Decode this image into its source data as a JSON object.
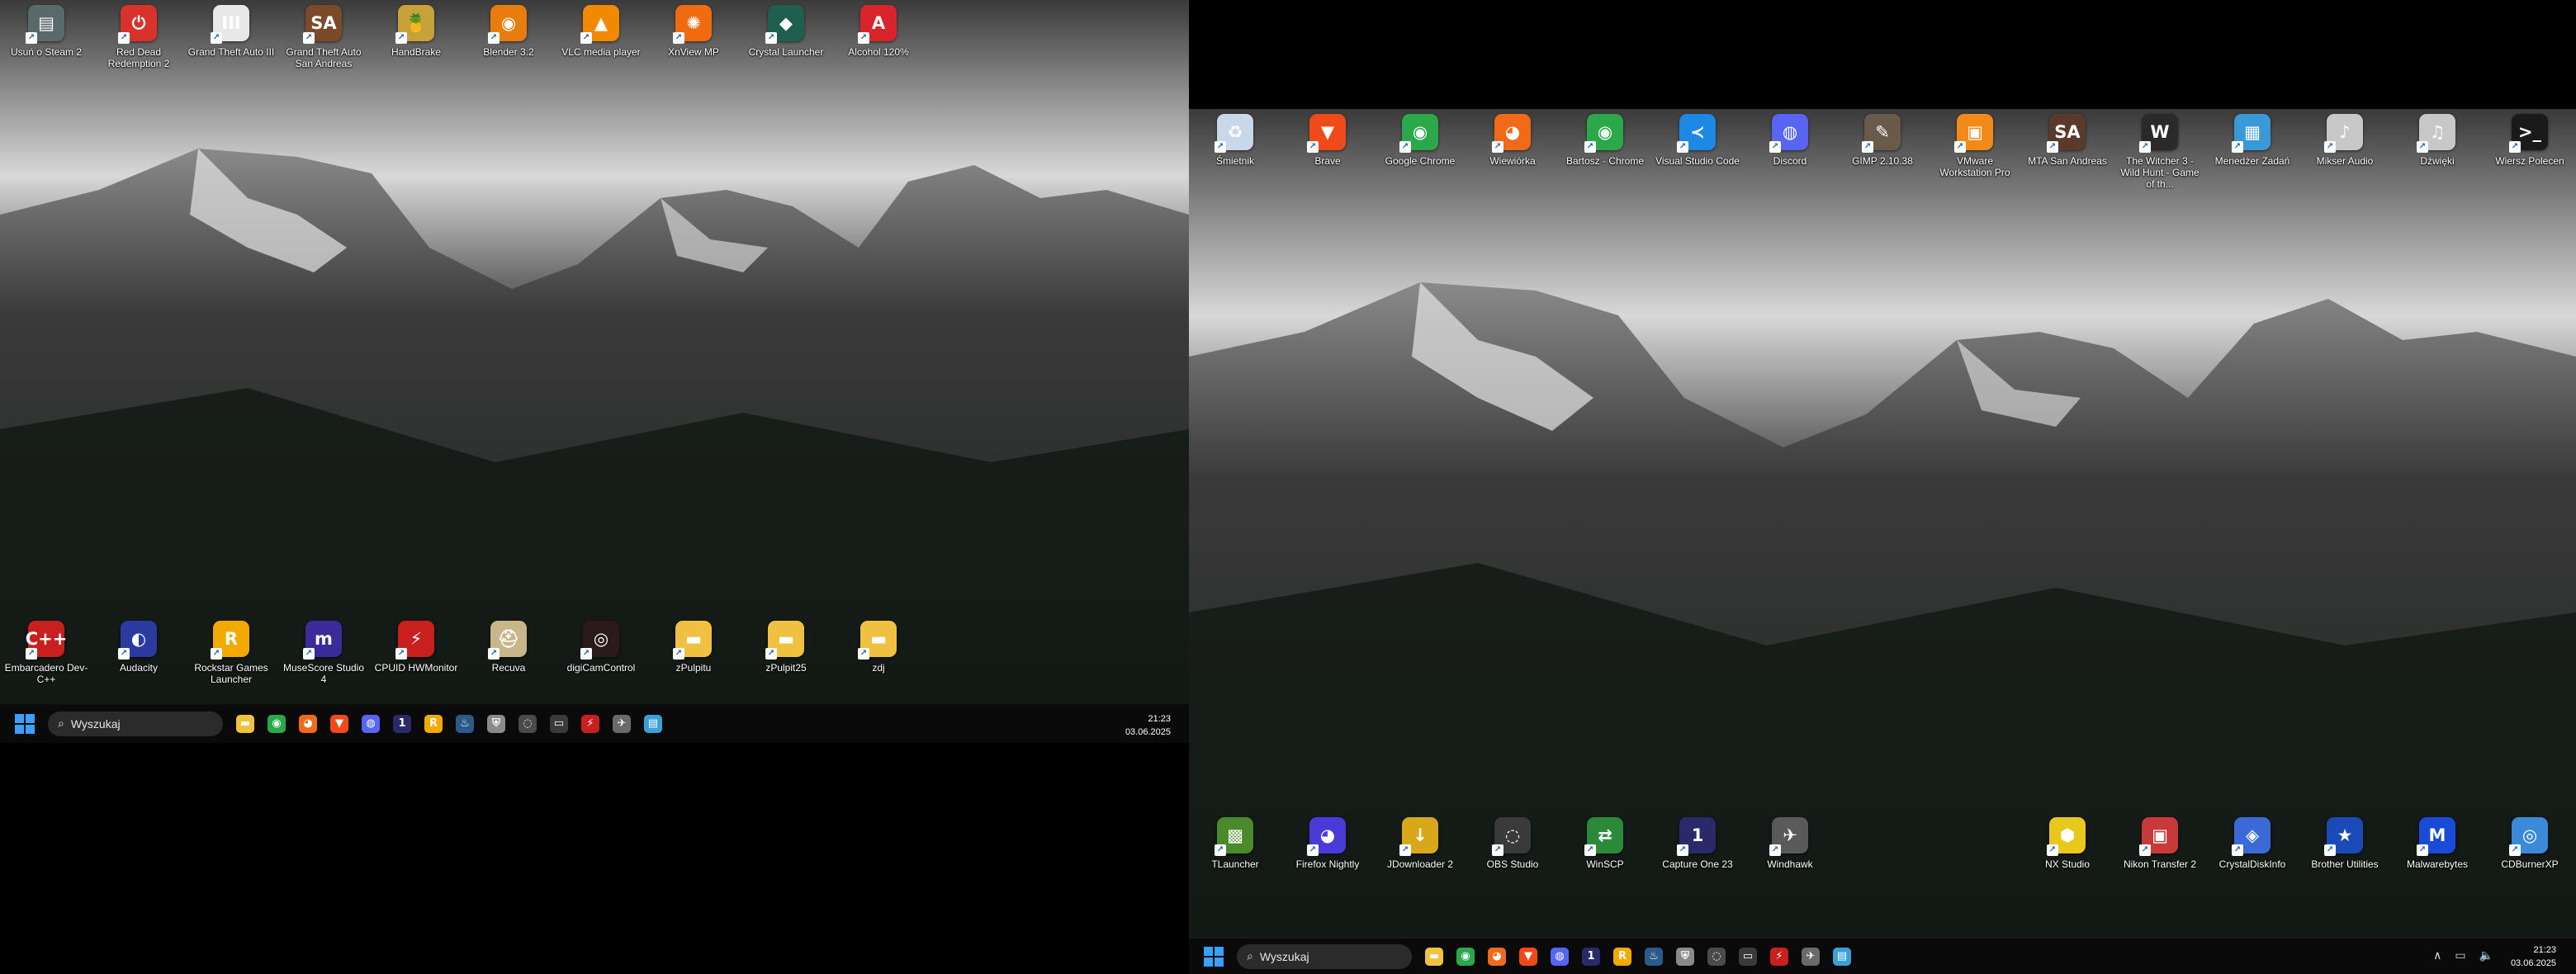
{
  "left_monitor": {
    "desktop_top_icons": [
      {
        "label": "Usuń o Steam 2",
        "icon": "steam-uninstall-icon",
        "color": "#5a6a6a",
        "glyph": "▤"
      },
      {
        "label": "Red Dead Redemption 2",
        "icon": "rdr2-icon",
        "color": "#d8322a",
        "glyph": "⏻"
      },
      {
        "label": "Grand Theft Auto III",
        "icon": "gta3-icon",
        "color": "#e8e8e8",
        "glyph": "III"
      },
      {
        "label": "Grand Theft Auto San Andreas",
        "icon": "gtasa-icon",
        "color": "#7a4a2a",
        "glyph": "SA"
      },
      {
        "label": "HandBrake",
        "icon": "handbrake-icon",
        "color": "#c7a23a",
        "glyph": "🍍"
      },
      {
        "label": "Blender 3.2",
        "icon": "blender-icon",
        "color": "#e87d0d",
        "glyph": "◉"
      },
      {
        "label": "VLC media player",
        "icon": "vlc-icon",
        "color": "#f18a00",
        "glyph": "▲"
      },
      {
        "label": "XnView MP",
        "icon": "xnview-icon",
        "color": "#f06a10",
        "glyph": "✺"
      },
      {
        "label": "Crystal Launcher",
        "icon": "crystal-launcher-icon",
        "color": "#1f5f4f",
        "glyph": "◆"
      },
      {
        "label": "Alcohol 120%",
        "icon": "alcohol-icon",
        "color": "#d8242a",
        "glyph": "A"
      }
    ],
    "desktop_bottom_icons": [
      {
        "label": "Embarcadero Dev-C++",
        "icon": "devcpp-icon",
        "color": "#c8201e",
        "glyph": "C++"
      },
      {
        "label": "Audacity",
        "icon": "audacity-icon",
        "color": "#2a3aa0",
        "glyph": "◐"
      },
      {
        "label": "Rockstar Games Launcher",
        "icon": "rockstar-icon",
        "color": "#f2a900",
        "glyph": "R"
      },
      {
        "label": "MuseScore Studio 4",
        "icon": "musescore-icon",
        "color": "#3b2a9a",
        "glyph": "m"
      },
      {
        "label": "CPUID HWMonitor",
        "icon": "hwmonitor-icon",
        "color": "#c8201e",
        "glyph": "⚡"
      },
      {
        "label": "Recuva",
        "icon": "recuva-icon",
        "color": "#c9b58a",
        "glyph": "⛑"
      },
      {
        "label": "digiCamControl",
        "icon": "digicamcontrol-icon",
        "color": "#2a1a1a",
        "glyph": "◎"
      },
      {
        "label": "zPulpitu",
        "icon": "folder-icon",
        "color": "#f0c040",
        "glyph": "▬"
      },
      {
        "label": "zPulpit25",
        "icon": "folder-icon",
        "color": "#f0c040",
        "glyph": "▬"
      },
      {
        "label": "zdj",
        "icon": "folder-icon",
        "color": "#f0c040",
        "glyph": "▬"
      }
    ],
    "taskbar": {
      "search_placeholder": "Wyszukaj",
      "time": "21:23",
      "date": "03.06.2025",
      "apps": [
        {
          "icon": "file-explorer-icon",
          "color": "#f3c23c",
          "glyph": "▬"
        },
        {
          "icon": "chrome-icon",
          "color": "#2aa84a",
          "glyph": "◉"
        },
        {
          "icon": "firefox-icon",
          "color": "#f06a1a",
          "glyph": "◕"
        },
        {
          "icon": "brave-icon",
          "color": "#f04a1a",
          "glyph": "▼"
        },
        {
          "icon": "discord-icon",
          "color": "#5865f2",
          "glyph": "◍"
        },
        {
          "icon": "capture-one-icon",
          "color": "#2a2a6a",
          "glyph": "1"
        },
        {
          "icon": "rockstar-icon",
          "color": "#f2a900",
          "glyph": "R"
        },
        {
          "icon": "steam-icon",
          "color": "#2a5a8a",
          "glyph": "♨"
        },
        {
          "icon": "shield-icon",
          "color": "#8a8a8a",
          "glyph": "⛨"
        },
        {
          "icon": "obs-icon",
          "color": "#4a4a4a",
          "glyph": "◌"
        },
        {
          "icon": "terminal-icon",
          "color": "#3a3a3a",
          "glyph": "▭"
        },
        {
          "icon": "hwmonitor-icon",
          "color": "#c8201e",
          "glyph": "⚡"
        },
        {
          "icon": "windhawk-icon",
          "color": "#6a6a6a",
          "glyph": "✈"
        },
        {
          "icon": "notepad-icon",
          "color": "#3aa0d8",
          "glyph": "▤"
        }
      ]
    }
  },
  "right_monitor": {
    "desktop_top_icons": [
      {
        "label": "Śmietnik",
        "icon": "recycle-bin-icon",
        "color": "#c8d8e8",
        "glyph": "♻"
      },
      {
        "label": "Brave",
        "icon": "brave-icon",
        "color": "#f04a1a",
        "glyph": "▼"
      },
      {
        "label": "Google Chrome",
        "icon": "chrome-icon",
        "color": "#2aa84a",
        "glyph": "◉"
      },
      {
        "label": "Wiewiórka",
        "icon": "firefox-icon",
        "color": "#f06a1a",
        "glyph": "◕"
      },
      {
        "label": "Bartosz - Chrome",
        "icon": "chrome-profile-icon",
        "color": "#2aa84a",
        "glyph": "◉"
      },
      {
        "label": "Visual Studio Code",
        "icon": "vscode-icon",
        "color": "#1e88e5",
        "glyph": "≺"
      },
      {
        "label": "Discord",
        "icon": "discord-icon",
        "color": "#5865f2",
        "glyph": "◍"
      },
      {
        "label": "GIMP 2.10.38",
        "icon": "gimp-icon",
        "color": "#6a5a4a",
        "glyph": "✎"
      },
      {
        "label": "VMware Workstation Pro",
        "icon": "vmware-icon",
        "color": "#f28a1a",
        "glyph": "▣"
      },
      {
        "label": "MTA San Andreas",
        "icon": "mta-icon",
        "color": "#5a3a2a",
        "glyph": "SA"
      },
      {
        "label": "The Witcher 3 - Wild Hunt - Game of th...",
        "icon": "witcher-icon",
        "color": "#2a2a2a",
        "glyph": "W"
      },
      {
        "label": "Menedżer Zadań",
        "icon": "task-manager-icon",
        "color": "#3a9ad8",
        "glyph": "▦"
      },
      {
        "label": "Mikser Audio",
        "icon": "audio-mixer-icon",
        "color": "#c8c8c8",
        "glyph": "♪"
      },
      {
        "label": "Dźwięki",
        "icon": "sounds-icon",
        "color": "#c8c8c8",
        "glyph": "♫"
      },
      {
        "label": "Wiersz Polecen",
        "icon": "cmd-icon",
        "color": "#1a1a1a",
        "glyph": ">_"
      }
    ],
    "desktop_bottom_icons_left": [
      {
        "label": "TLauncher",
        "icon": "tlauncher-icon",
        "color": "#4a8a2a",
        "glyph": "▩"
      },
      {
        "label": "Firefox Nightly",
        "icon": "firefox-nightly-icon",
        "color": "#4a3ad8",
        "glyph": "◕"
      },
      {
        "label": "JDownloader 2",
        "icon": "jdownloader-icon",
        "color": "#d8a81a",
        "glyph": "↓"
      },
      {
        "label": "OBS Studio",
        "icon": "obs-icon",
        "color": "#3a3a3a",
        "glyph": "◌"
      },
      {
        "label": "WinSCP",
        "icon": "winscp-icon",
        "color": "#2a8a3a",
        "glyph": "⇄"
      },
      {
        "label": "Capture One 23",
        "icon": "capture-one-icon",
        "color": "#2a2a6a",
        "glyph": "1"
      },
      {
        "label": "Windhawk",
        "icon": "windhawk-icon",
        "color": "#5a5a5a",
        "glyph": "✈"
      }
    ],
    "desktop_bottom_icons_right": [
      {
        "label": "NX Studio",
        "icon": "nx-studio-icon",
        "color": "#e8c81a",
        "glyph": "⬢"
      },
      {
        "label": "Nikon Transfer 2",
        "icon": "nikon-transfer-icon",
        "color": "#c83a3a",
        "glyph": "▣"
      },
      {
        "label": "CrystalDiskInfo",
        "icon": "crystaldiskinfo-icon",
        "color": "#3a6ad8",
        "glyph": "◈"
      },
      {
        "label": "Brother Utilities",
        "icon": "brother-utilities-icon",
        "color": "#1a4ab8",
        "glyph": "★"
      },
      {
        "label": "Malwarebytes",
        "icon": "malwarebytes-icon",
        "color": "#1a4ad8",
        "glyph": "M"
      },
      {
        "label": "CDBurnerXP",
        "icon": "cdburnerxp-icon",
        "color": "#3a8ad8",
        "glyph": "◎"
      }
    ],
    "taskbar": {
      "search_placeholder": "Wyszukaj",
      "time": "21:23",
      "date": "03.06.2025",
      "apps": [
        {
          "icon": "file-explorer-icon",
          "color": "#f3c23c",
          "glyph": "▬"
        },
        {
          "icon": "chrome-icon",
          "color": "#2aa84a",
          "glyph": "◉"
        },
        {
          "icon": "firefox-icon",
          "color": "#f06a1a",
          "glyph": "◕"
        },
        {
          "icon": "brave-icon",
          "color": "#f04a1a",
          "glyph": "▼"
        },
        {
          "icon": "discord-icon",
          "color": "#5865f2",
          "glyph": "◍"
        },
        {
          "icon": "capture-one-icon",
          "color": "#2a2a6a",
          "glyph": "1"
        },
        {
          "icon": "rockstar-icon",
          "color": "#f2a900",
          "glyph": "R"
        },
        {
          "icon": "steam-icon",
          "color": "#2a5a8a",
          "glyph": "♨"
        },
        {
          "icon": "shield-icon",
          "color": "#8a8a8a",
          "glyph": "⛨"
        },
        {
          "icon": "obs-icon",
          "color": "#4a4a4a",
          "glyph": "◌"
        },
        {
          "icon": "terminal-icon",
          "color": "#3a3a3a",
          "glyph": "▭"
        },
        {
          "icon": "hwmonitor-icon",
          "color": "#c8201e",
          "glyph": "⚡"
        },
        {
          "icon": "windhawk-icon",
          "color": "#6a6a6a",
          "glyph": "✈"
        },
        {
          "icon": "notepad-icon",
          "color": "#3aa0d8",
          "glyph": "▤"
        }
      ],
      "tray": [
        {
          "icon": "chevron-up-icon",
          "glyph": "∧"
        },
        {
          "icon": "network-icon",
          "glyph": "▭"
        },
        {
          "icon": "volume-icon",
          "glyph": "🔈"
        }
      ]
    }
  }
}
